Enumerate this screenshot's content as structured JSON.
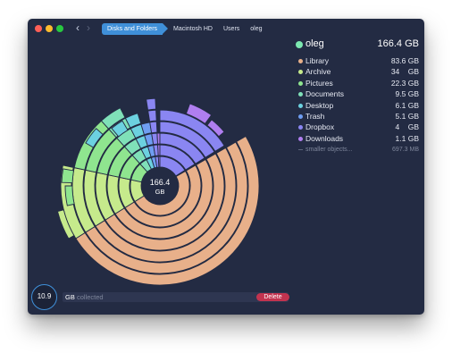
{
  "navigation": {
    "back_icon": "chevron-left-icon",
    "forward_icon": "chevron-right-icon",
    "breadcrumbs": [
      {
        "label": "Disks and Folders"
      },
      {
        "label": "Macintosh HD"
      },
      {
        "label": "Users"
      },
      {
        "label": "oleg"
      }
    ]
  },
  "chart_center": {
    "size_value": "166.4",
    "size_unit": "GB"
  },
  "summary": {
    "name": "oleg",
    "size": "166.4 GB",
    "color": "#7ce7b0"
  },
  "legend": [
    {
      "name": "Library",
      "size": "83.6 GB",
      "color": "#e8b08a"
    },
    {
      "name": "Archive",
      "size": "34    GB",
      "color": "#c6ea8c"
    },
    {
      "name": "Pictures",
      "size": "22.3 GB",
      "color": "#8fe58f"
    },
    {
      "name": "Documents",
      "size": "9.5 GB",
      "color": "#7fe0b8"
    },
    {
      "name": "Desktop",
      "size": "6.1 GB",
      "color": "#6cd1e0"
    },
    {
      "name": "Trash",
      "size": "5.1 GB",
      "color": "#6f9ef2"
    },
    {
      "name": "Dropbox",
      "size": "4    GB",
      "color": "#8a86f2"
    },
    {
      "name": "Downloads",
      "size": "1.1 GB",
      "color": "#b07ef0"
    },
    {
      "name": "smaller objects...",
      "size": "697.3 MB",
      "color": "#5d667c"
    }
  ],
  "footer": {
    "collected_amount": "10.9",
    "collected_unit": "GB",
    "collected_label": "collected",
    "delete_label": "Delete",
    "accent_color": "#3f8fd8",
    "delete_color": "#c2334f"
  }
}
